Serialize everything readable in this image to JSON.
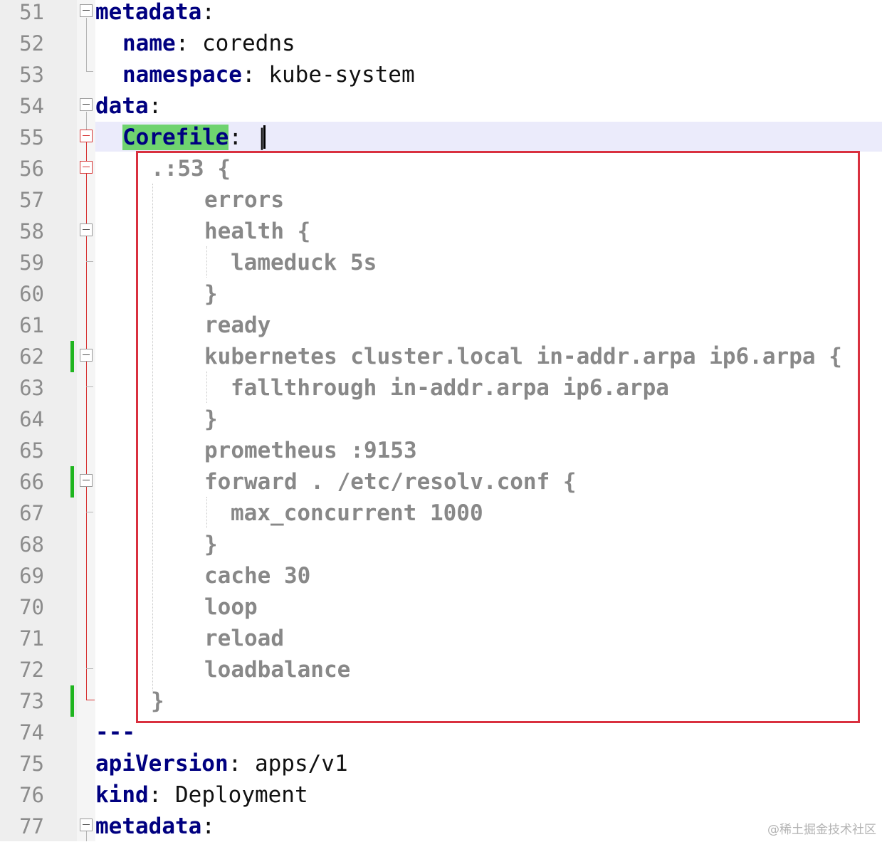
{
  "editor": {
    "line_numbers": [
      "51",
      "52",
      "53",
      "54",
      "55",
      "56",
      "57",
      "58",
      "59",
      "60",
      "61",
      "62",
      "63",
      "64",
      "65",
      "66",
      "67",
      "68",
      "69",
      "70",
      "71",
      "72",
      "73",
      "74",
      "75",
      "76",
      "77"
    ],
    "lines": {
      "l51": {
        "key": "metadata",
        "sep": ":"
      },
      "l52": {
        "key": "name",
        "sep": ":",
        "value": "coredns"
      },
      "l53": {
        "key": "namespace",
        "sep": ":",
        "value": "kube-system"
      },
      "l54": {
        "key": "data",
        "sep": ":"
      },
      "l55": {
        "key": "Corefile",
        "sep": ":",
        "value": "|"
      },
      "l74": {
        "text": "---"
      },
      "l75": {
        "key": "apiVersion",
        "sep": ":",
        "value": "apps/v1"
      },
      "l76": {
        "key": "kind",
        "sep": ":",
        "value": "Deployment"
      },
      "l77": {
        "key": "metadata",
        "sep": ":"
      }
    },
    "corefile": [
      ".:53 {",
      "errors",
      "health {",
      "lameduck 5s",
      "}",
      "ready",
      "kubernetes cluster.local in-addr.arpa ip6.arpa {",
      "fallthrough in-addr.arpa ip6.arpa",
      "}",
      "prometheus :9153",
      "forward . /etc/resolv.conf {",
      "max_concurrent 1000",
      "}",
      "cache 30",
      "loop",
      "reload",
      "loadbalance",
      "}"
    ],
    "colors": {
      "highlight_box": "#d9303f",
      "key": "#000080",
      "corefile_text": "#888888",
      "current_line": "#ebebfb",
      "search_highlight": "#6fd36f",
      "change_marker": "#1fb51f"
    }
  },
  "watermark": "@稀土掘金技术社区"
}
